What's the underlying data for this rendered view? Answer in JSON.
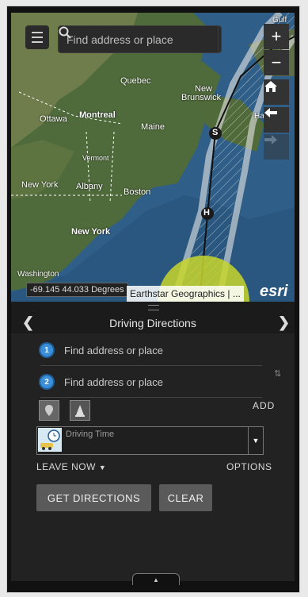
{
  "search": {
    "placeholder": "Find address or place"
  },
  "map": {
    "labels": {
      "quebec": "Quebec",
      "new_brunswick_1": "New",
      "new_brunswick_2": "Brunswick",
      "ottawa": "Ottawa",
      "montreal": "Montreal",
      "maine": "Maine",
      "halifax": "Halifax",
      "vermont": "Vermont",
      "new_york_state": "New York",
      "albany": "Albany",
      "boston": "Boston",
      "new_york_city": "New York",
      "washington": "Washington",
      "gulf": "Gulf",
      "storm_s1": "S",
      "storm_s2": "S",
      "storm_h": "H"
    },
    "coordinates": "-69.145 44.033 Degrees",
    "attribution": "Earthstar Geographics | ...",
    "logo": "esri"
  },
  "panel": {
    "title": "Driving Directions",
    "stops": [
      {
        "number": "1",
        "placeholder": "Find address or place"
      },
      {
        "number": "2",
        "placeholder": "Find address or place"
      }
    ],
    "add_label": "ADD",
    "travel_mode": "Driving Time",
    "leave_now": "LEAVE NOW",
    "options": "OPTIONS",
    "get_directions": "GET DIRECTIONS",
    "clear": "CLEAR"
  },
  "colors": {
    "accent": "#3a8fd8",
    "panel": "#222222",
    "button": "#5a5a5a"
  }
}
